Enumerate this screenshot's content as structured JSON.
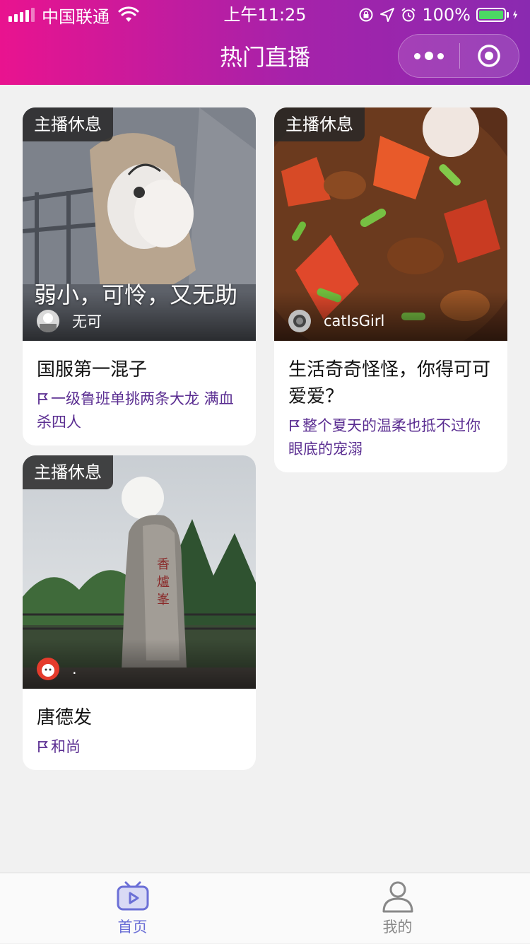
{
  "status_bar": {
    "carrier": "中国联通",
    "time": "上午11:25",
    "battery_percent": "100%",
    "battery_level": 1.0
  },
  "header": {
    "title": "热门直播",
    "background_colors": [
      "#e9138f",
      "#8a2ab0"
    ]
  },
  "cards": [
    {
      "status_tag": "主播休息",
      "cover_caption": "弱小，可怜，又无助",
      "host_name": "无可",
      "title": "国服第一混子",
      "description": "一级鲁班单挑两条大龙 满血杀四人"
    },
    {
      "status_tag": "主播休息",
      "cover_caption": "",
      "host_name": "catIsGirl",
      "title": "生活奇奇怪怪，你得可可爱爱？",
      "description": "整个夏天的温柔也抵不过你眼底的宠溺"
    },
    {
      "status_tag": "主播休息",
      "cover_caption": "",
      "host_name": ".",
      "title": "唐德发",
      "description": "和尚"
    }
  ],
  "tabbar": {
    "items": [
      {
        "label": "首页",
        "icon": "tv-play-icon",
        "active": true
      },
      {
        "label": "我的",
        "icon": "person-icon",
        "active": false
      }
    ],
    "active_color": "#6b6fd6"
  },
  "colors": {
    "description_text": "#5a2d91",
    "page_background": "#f1f1f1"
  }
}
